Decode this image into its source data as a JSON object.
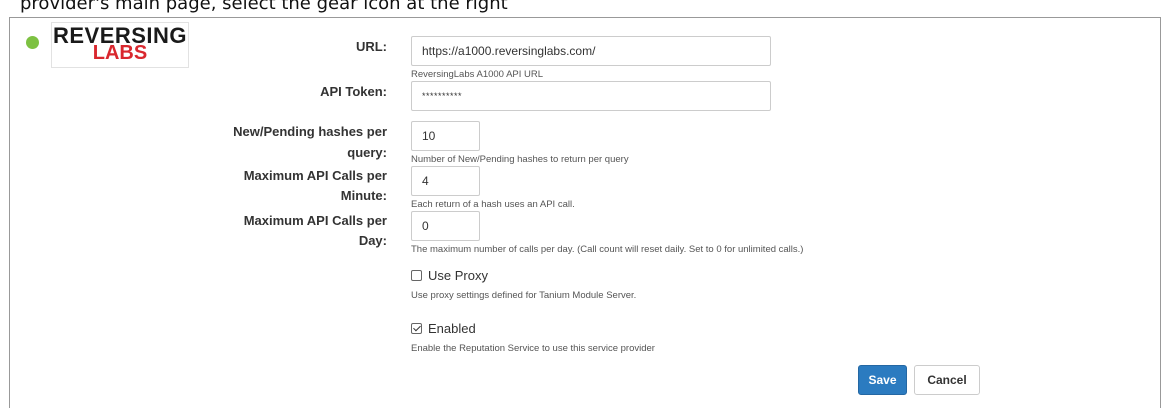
{
  "caption": "provider's main page, select the gear icon at the right",
  "provider": {
    "status": "active",
    "status_color": "#7dc142",
    "logo_line1": "REVERSING",
    "logo_line2": "LABS"
  },
  "form": {
    "url": {
      "label": "URL:",
      "value": "https://a1000.reversinglabs.com/",
      "help": "ReversingLabs A1000 API URL"
    },
    "api_token": {
      "label": "API Token:",
      "value": "**********"
    },
    "hashes_per_query": {
      "label_line1": "New/Pending hashes per",
      "label_line2": "query:",
      "value": "10",
      "help": "Number of New/Pending hashes to return per query"
    },
    "calls_per_minute": {
      "label_line1": "Maximum API Calls per",
      "label_line2": "Minute:",
      "value": "4",
      "help": "Each return of a hash uses an API call."
    },
    "calls_per_day": {
      "label_line1": "Maximum API Calls per",
      "label_line2": "Day:",
      "value": "0",
      "help": "The maximum number of calls per day. (Call count will reset daily. Set to 0 for unlimited calls.)"
    },
    "use_proxy": {
      "label": "Use Proxy",
      "checked": false,
      "help": "Use proxy settings defined for Tanium Module Server."
    },
    "enabled": {
      "label": "Enabled",
      "checked": true,
      "help": "Enable the Reputation Service to use this service provider"
    }
  },
  "actions": {
    "save_label": "Save",
    "save_color": "#2b7bc0",
    "cancel_label": "Cancel"
  }
}
